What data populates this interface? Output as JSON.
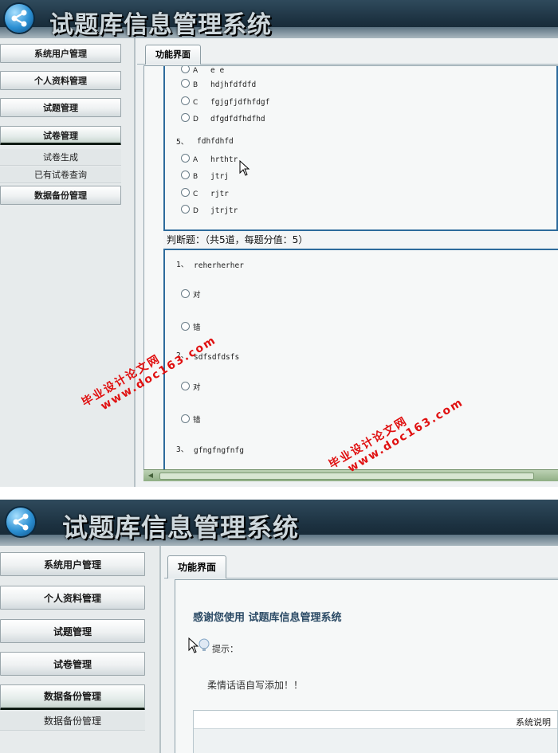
{
  "app": {
    "title": "试题库信息管理系统"
  },
  "screen1": {
    "menu": [
      {
        "label": "系统用户管理"
      },
      {
        "label": "个人资料管理"
      },
      {
        "label": "试题管理"
      },
      {
        "label": "试卷管理"
      }
    ],
    "submenu": [
      {
        "label": "试卷生成"
      },
      {
        "label": "已有试卷查询"
      }
    ],
    "menu_after": {
      "label": "数据备份管理"
    },
    "tab": "功能界面",
    "q4_options": [
      {
        "letter": "A",
        "text": "e e"
      },
      {
        "letter": "B",
        "text": "hdjhfdfdfd"
      },
      {
        "letter": "C",
        "text": "fgjgfjdfhfdgf"
      },
      {
        "letter": "D",
        "text": "dfgdfdfhdfhd"
      }
    ],
    "q5": {
      "number": "5、",
      "text": "fdhfdhfd"
    },
    "q5_options": [
      {
        "letter": "A",
        "text": "hrthtr"
      },
      {
        "letter": "B",
        "text": "jtrj"
      },
      {
        "letter": "C",
        "text": "rjtr"
      },
      {
        "letter": "D",
        "text": "jtrjtr"
      }
    ],
    "judge_header": "判断题：（共5道，每题分值：5）",
    "judge": [
      {
        "number": "1、",
        "text": "reherherher",
        "true_label": "对",
        "false_label": "错"
      },
      {
        "number": "2、",
        "text": "sdfsdfdsfs",
        "true_label": "对",
        "false_label": "错"
      },
      {
        "number": "3、",
        "text": "gfngfngfnfg"
      }
    ]
  },
  "screen2": {
    "menu": [
      {
        "label": "系统用户管理"
      },
      {
        "label": "个人资料管理"
      },
      {
        "label": "试题管理"
      },
      {
        "label": "试卷管理"
      },
      {
        "label": "数据备份管理"
      }
    ],
    "submenu": [
      {
        "label": "数据备份管理"
      }
    ],
    "tab": "功能界面",
    "welcome": "感谢您使用 试题库信息管理系统",
    "hint": "提示：",
    "notice": "柔情话语自写添加！！",
    "sys_box_title": "系统说明"
  },
  "watermark": {
    "cn": "毕业设计论文网",
    "url": "www.doc163.com"
  }
}
